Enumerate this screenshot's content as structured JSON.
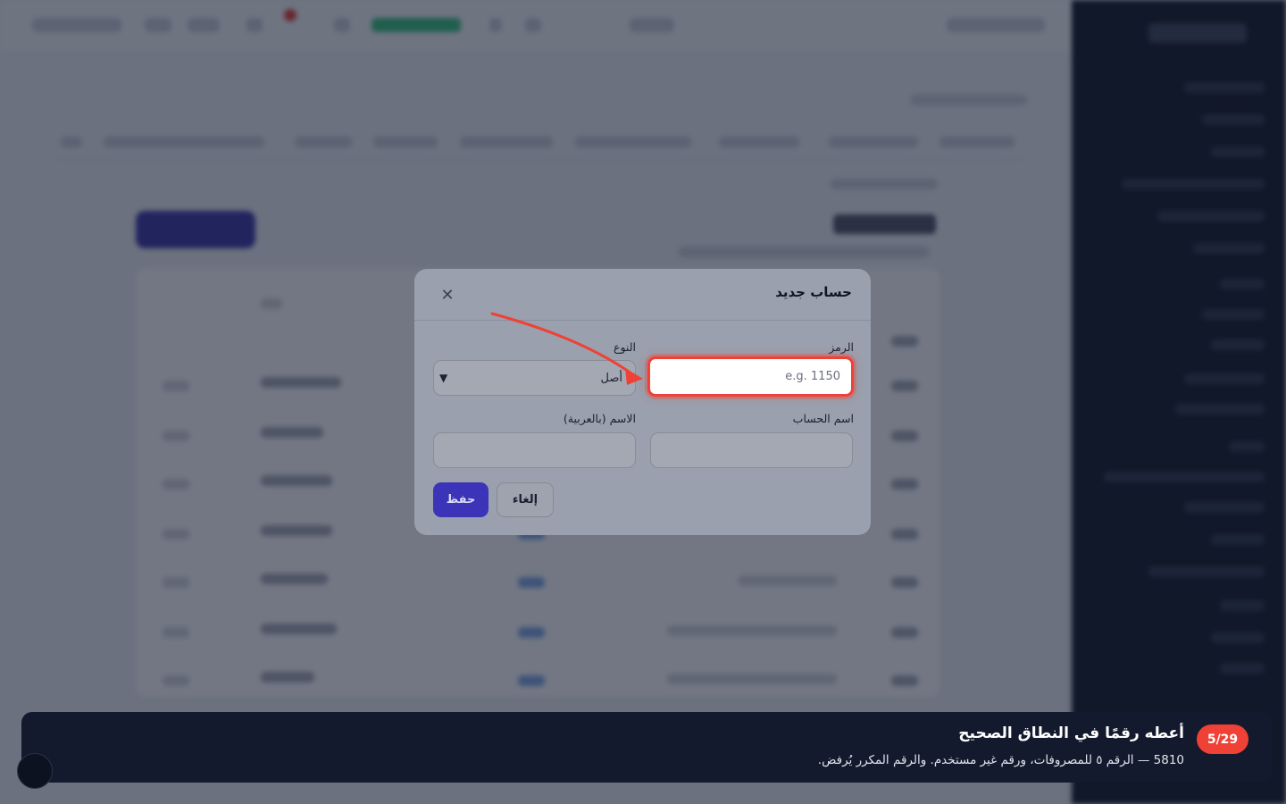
{
  "modal": {
    "title": "حساب جديد",
    "close_icon": "close-icon",
    "fields": {
      "code": {
        "label": "الرمز",
        "value": "",
        "placeholder": "e.g. 1150"
      },
      "type": {
        "label": "النوع",
        "value": "أصل",
        "icon": "chevron-down-icon"
      },
      "account_name": {
        "label": "اسم الحساب",
        "value": ""
      },
      "arabic_name": {
        "label": "الاسم (بالعربية)",
        "value": ""
      }
    },
    "buttons": {
      "save": "حفظ",
      "cancel": "إلغاء"
    }
  },
  "tutorial": {
    "step": "5/29",
    "title": "أعطه رقمًا في النطاق الصحيح",
    "description": "5810 — الرقم ٥ للمصروفات، ورقم غير مستخدم. والرقم المكرر يُرفض."
  },
  "colors": {
    "highlight": "#ef4135",
    "primary": "#3b33b8",
    "banner_bg": "#131a2d"
  }
}
